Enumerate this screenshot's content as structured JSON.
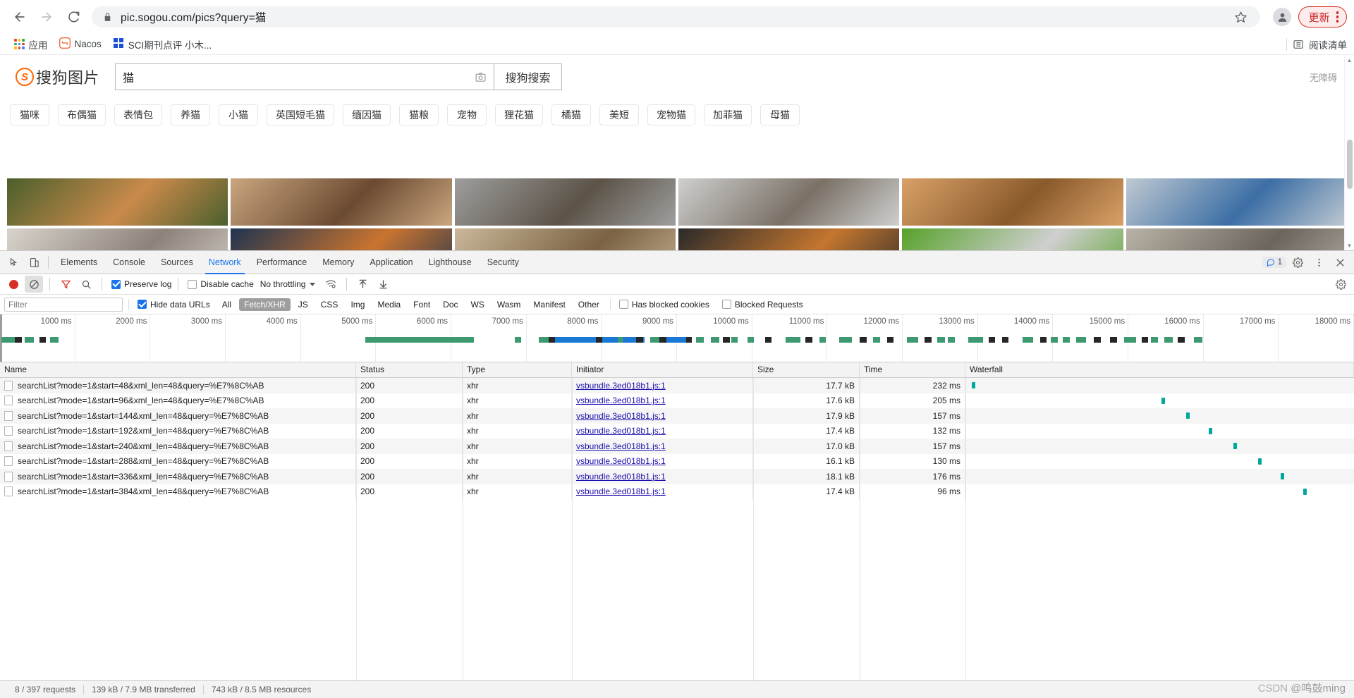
{
  "browser": {
    "url": "pic.sogou.com/pics?query=猫",
    "back_title": "Back",
    "forward_title": "Forward",
    "reload_title": "Reload",
    "update_button_label": "更新",
    "bookmarks": [
      {
        "label": "应用",
        "icon": "apps-grid-icon"
      },
      {
        "label": "Nacos",
        "icon": "nacos-icon"
      },
      {
        "label": "SCI期刊点评 小木...",
        "icon": "sci-icon"
      }
    ],
    "reading_list_label": "阅读清单"
  },
  "sogou": {
    "logo_text": "搜狗图片",
    "logo_mark": "S",
    "search_value": "猫",
    "search_placeholder": "",
    "camera_icon": "camera-icon",
    "submit_label": "搜狗搜索",
    "accessibility_label": "无障碍",
    "tags": [
      "猫咪",
      "布偶猫",
      "表情包",
      "养猫",
      "小猫",
      "英国短毛猫",
      "缅因猫",
      "猫粮",
      "宠物",
      "狸花猫",
      "橘猫",
      "美短",
      "宠物猫",
      "加菲猫",
      "母猫"
    ],
    "row1_tiles": [
      {
        "name": "orange-cat-sleeping-on-wood",
        "c1": "#4b5f2c",
        "c2": "#c98a4b"
      },
      {
        "name": "cat-paws-on-table",
        "c1": "#caa77f",
        "c2": "#6b4a32"
      },
      {
        "name": "tabby-cat-lying",
        "c1": "#9e9e9e",
        "c2": "#5c5347"
      },
      {
        "name": "two-kittens-legs",
        "c1": "#cfcfcf",
        "c2": "#7a7166"
      },
      {
        "name": "orange-cat-standing",
        "c1": "#d9a168",
        "c2": "#8a5a2b"
      },
      {
        "name": "cat-on-blue-surface",
        "c1": "#bfc9d1",
        "c2": "#3c6ea5"
      }
    ],
    "row2_tiles": [
      {
        "name": "gray-kitten-portrait",
        "c1": "#d9d4cd",
        "c2": "#8c8279"
      },
      {
        "name": "orange-cat-with-person",
        "c1": "#1f3350",
        "c2": "#c9742f"
      },
      {
        "name": "persian-cat-face",
        "c1": "#cbb79a",
        "c2": "#7a6243"
      },
      {
        "name": "black-and-orange-cats",
        "c1": "#2a2a2a",
        "c2": "#c4762f"
      },
      {
        "name": "white-kitten-on-grass",
        "c1": "#57a12a",
        "c2": "#cfcfcf"
      },
      {
        "name": "gray-tabby-close-up",
        "c1": "#b9b2a7",
        "c2": "#6c655c"
      }
    ]
  },
  "devtools": {
    "tabs": [
      {
        "label": "Elements",
        "active": false
      },
      {
        "label": "Console",
        "active": false
      },
      {
        "label": "Sources",
        "active": false
      },
      {
        "label": "Network",
        "active": true
      },
      {
        "label": "Performance",
        "active": false
      },
      {
        "label": "Memory",
        "active": false
      },
      {
        "label": "Application",
        "active": false
      },
      {
        "label": "Lighthouse",
        "active": false
      },
      {
        "label": "Security",
        "active": false
      }
    ],
    "message_count": "1",
    "toolbar": {
      "record_title": "Stop recording network log",
      "clear_title": "Clear",
      "filter_title": "Filter",
      "search_title": "Search",
      "preserve_log_label": "Preserve log",
      "preserve_log_checked": true,
      "disable_cache_label": "Disable cache",
      "disable_cache_checked": false,
      "throttling_value": "No throttling",
      "import_title": "Import HAR file",
      "export_title": "Export HAR file"
    },
    "filterbar": {
      "filter_placeholder": "Filter",
      "filter_value": "",
      "hide_data_urls_label": "Hide data URLs",
      "hide_data_urls_checked": true,
      "types": [
        {
          "label": "All",
          "active": false
        },
        {
          "label": "Fetch/XHR",
          "active": true
        },
        {
          "label": "JS",
          "active": false
        },
        {
          "label": "CSS",
          "active": false
        },
        {
          "label": "Img",
          "active": false
        },
        {
          "label": "Media",
          "active": false
        },
        {
          "label": "Font",
          "active": false
        },
        {
          "label": "Doc",
          "active": false
        },
        {
          "label": "WS",
          "active": false
        },
        {
          "label": "Wasm",
          "active": false
        },
        {
          "label": "Manifest",
          "active": false
        },
        {
          "label": "Other",
          "active": false
        }
      ],
      "has_blocked_cookies_label": "Has blocked cookies",
      "has_blocked_cookies_checked": false,
      "blocked_requests_label": "Blocked Requests",
      "blocked_requests_checked": false
    },
    "overview": {
      "ticks": [
        "1000 ms",
        "2000 ms",
        "3000 ms",
        "4000 ms",
        "5000 ms",
        "6000 ms",
        "7000 ms",
        "8000 ms",
        "9000 ms",
        "10000 ms",
        "11000 ms",
        "12000 ms",
        "13000 ms",
        "14000 ms",
        "15000 ms",
        "16000 ms",
        "17000 ms",
        "18000 ms"
      ]
    },
    "columns": [
      "Name",
      "Status",
      "Type",
      "Initiator",
      "Size",
      "Time",
      "Waterfall"
    ],
    "rows": [
      {
        "name": "searchList?mode=1&start=48&xml_len=48&query=%E7%8C%AB",
        "status": "200",
        "type": "xhr",
        "initiator": "vsbundle.3ed018b1.js:1",
        "size": "17.7 kB",
        "time": "232 ms",
        "wf_left_pct": 0.6
      },
      {
        "name": "searchList?mode=1&start=96&xml_len=48&query=%E7%8C%AB",
        "status": "200",
        "type": "xhr",
        "initiator": "vsbundle.3ed018b1.js:1",
        "size": "17.6 kB",
        "time": "205 ms",
        "wf_left_pct": 50.5
      },
      {
        "name": "searchList?mode=1&start=144&xml_len=48&query=%E7%8C%AB",
        "status": "200",
        "type": "xhr",
        "initiator": "vsbundle.3ed018b1.js:1",
        "size": "17.9 kB",
        "time": "157 ms",
        "wf_left_pct": 57.0
      },
      {
        "name": "searchList?mode=1&start=192&xml_len=48&query=%E7%8C%AB",
        "status": "200",
        "type": "xhr",
        "initiator": "vsbundle.3ed018b1.js:1",
        "size": "17.4 kB",
        "time": "132 ms",
        "wf_left_pct": 63.0
      },
      {
        "name": "searchList?mode=1&start=240&xml_len=48&query=%E7%8C%AB",
        "status": "200",
        "type": "xhr",
        "initiator": "vsbundle.3ed018b1.js:1",
        "size": "17.0 kB",
        "time": "157 ms",
        "wf_left_pct": 69.5
      },
      {
        "name": "searchList?mode=1&start=288&xml_len=48&query=%E7%8C%AB",
        "status": "200",
        "type": "xhr",
        "initiator": "vsbundle.3ed018b1.js:1",
        "size": "16.1 kB",
        "time": "130 ms",
        "wf_left_pct": 76.0
      },
      {
        "name": "searchList?mode=1&start=336&xml_len=48&query=%E7%8C%AB",
        "status": "200",
        "type": "xhr",
        "initiator": "vsbundle.3ed018b1.js:1",
        "size": "18.1 kB",
        "time": "176 ms",
        "wf_left_pct": 82.0
      },
      {
        "name": "searchList?mode=1&start=384&xml_len=48&query=%E7%8C%AB",
        "status": "200",
        "type": "xhr",
        "initiator": "vsbundle.3ed018b1.js:1",
        "size": "17.4 kB",
        "time": "96 ms",
        "wf_left_pct": 88.0
      }
    ],
    "status_bar": {
      "requests": "8 / 397 requests",
      "transferred": "139 kB / 7.9 MB transferred",
      "resources": "743 kB / 8.5 MB resources"
    }
  },
  "watermark": {
    "prefix": "CSDN",
    "suffix": " @鸣鼓ming"
  }
}
